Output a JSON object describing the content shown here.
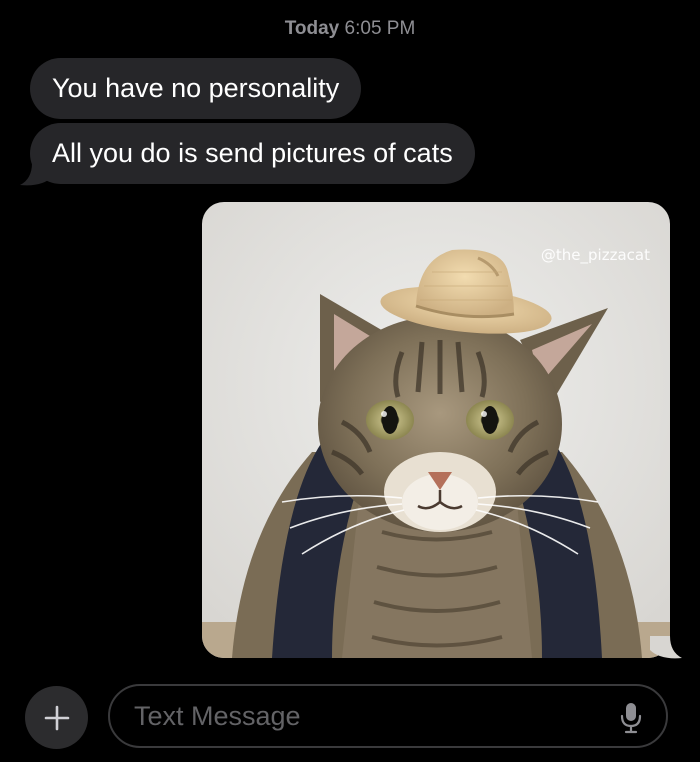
{
  "header": {
    "day": "Today",
    "time": "6:05 PM"
  },
  "messages": {
    "incoming": [
      {
        "text": "You have no personality"
      },
      {
        "text": "All you do is send pictures of cats"
      }
    ],
    "outgoing_photo": {
      "watermark": "@the_pizzacat",
      "subject": "tabby-cat-with-straw-cowboy-hat"
    }
  },
  "composer": {
    "add_icon": "plus-icon",
    "placeholder": "Text Message",
    "mic_icon": "microphone-icon"
  },
  "colors": {
    "background": "#000000",
    "incoming_bubble": "#262629",
    "timestamp": "#8e8e93",
    "placeholder": "#636366"
  }
}
